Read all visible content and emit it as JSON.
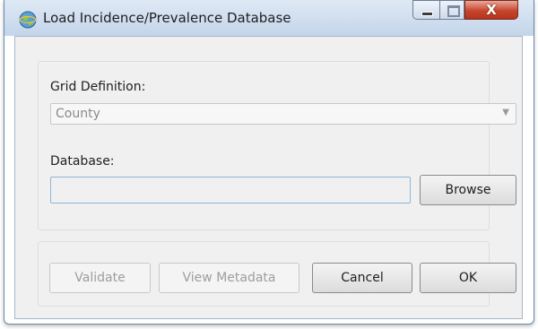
{
  "window": {
    "title": "Load Incidence/Prevalence Database",
    "close_glyph": "X"
  },
  "form": {
    "grid_definition_label": "Grid Definition:",
    "grid_definition_value": "County",
    "database_label": "Database:",
    "database_value": "",
    "browse_label": "Browse"
  },
  "actions": {
    "validate_label": "Validate",
    "view_metadata_label": "View Metadata",
    "cancel_label": "Cancel",
    "ok_label": "OK"
  },
  "icons": {
    "app": "globe-icon",
    "minimize": "minimize-icon",
    "maximize": "maximize-icon",
    "close": "close-icon",
    "dropdown": "chevron-down-icon"
  },
  "colors": {
    "titlebar": "#c3d5ea",
    "close_button": "#c6462c",
    "client_bg": "#f0f0f0",
    "disabled_text": "#9d9d9d"
  }
}
